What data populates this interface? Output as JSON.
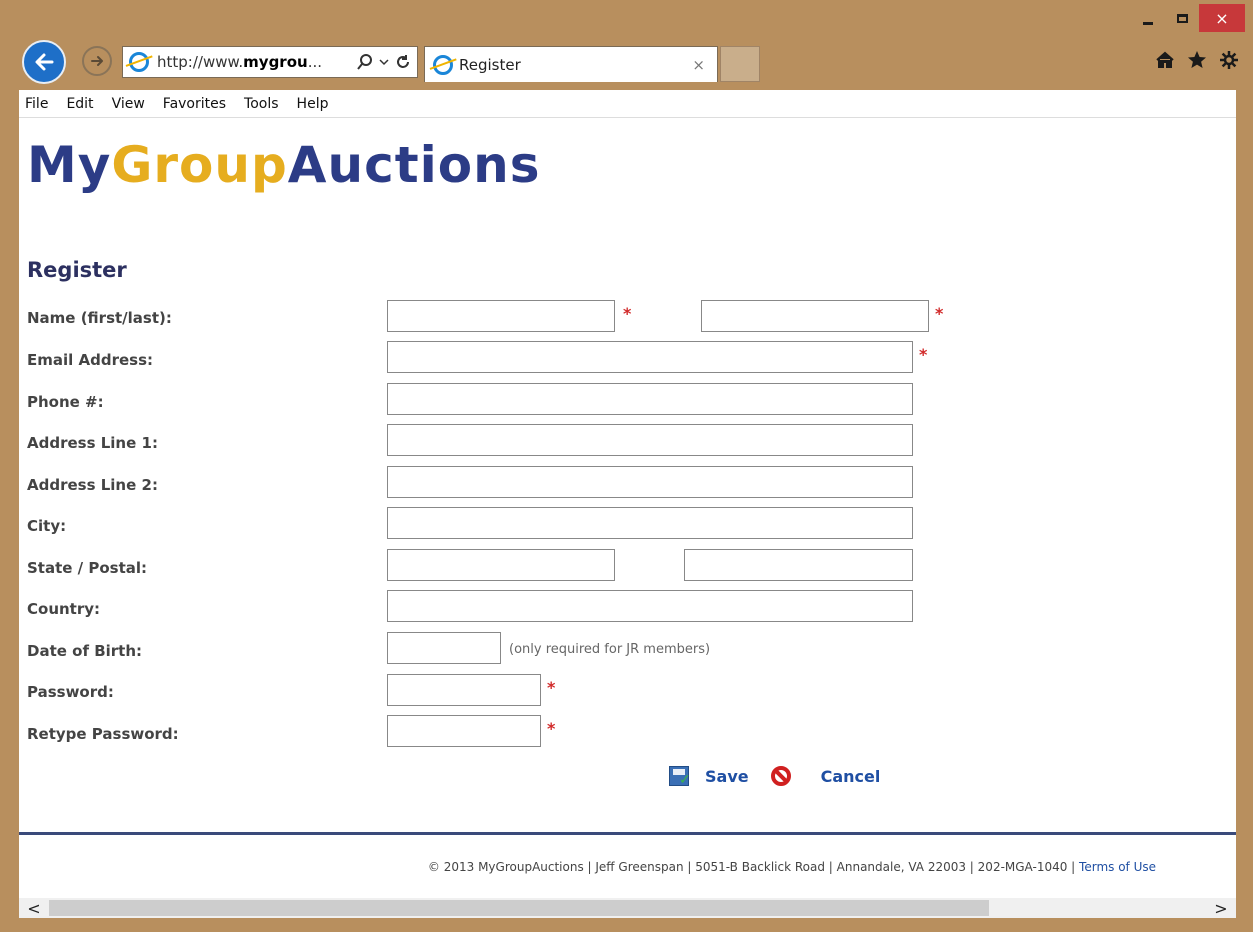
{
  "window": {
    "close_glyph": "×"
  },
  "browser": {
    "address_prefix": "http://www.",
    "address_domain": "mygrou",
    "address_suffix": "...",
    "tab_title": "Register",
    "tab_close_glyph": "×"
  },
  "menu": [
    "File",
    "Edit",
    "View",
    "Favorites",
    "Tools",
    "Help"
  ],
  "logo": {
    "my": "My",
    "group": "Group",
    "auctions": "Auctions"
  },
  "page": {
    "heading": "Register",
    "labels": {
      "name": "Name (first/last):",
      "email": "Email Address:",
      "phone": "Phone #:",
      "address1": "Address Line 1:",
      "address2": "Address Line 2:",
      "city": "City:",
      "state_postal": "State / Postal:",
      "country": "Country:",
      "dob": "Date of Birth:",
      "password": "Password:",
      "retype": "Retype Password:"
    },
    "required_marker": "*",
    "dob_note": "(only required for JR members)",
    "actions": {
      "save": "Save",
      "cancel": "Cancel"
    }
  },
  "footer": {
    "text": "© 2013 MyGroupAuctions | Jeff Greenspan | 5051-B Backlick Road | Annandale, VA 22003 | 202-MGA-1040 | ",
    "terms": "Terms of Use"
  },
  "scroll": {
    "left": "<",
    "right": ">"
  }
}
